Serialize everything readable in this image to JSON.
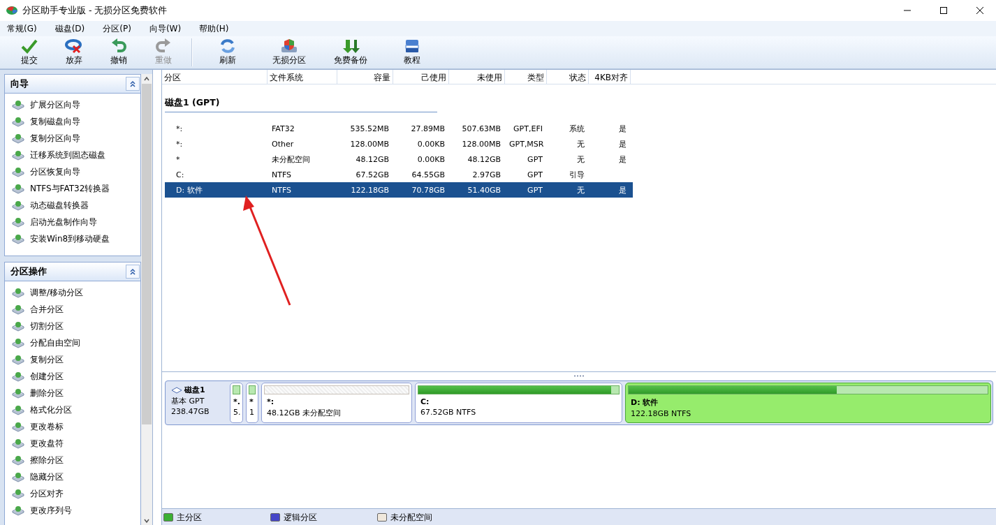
{
  "window": {
    "title": "分区助手专业版 - 无损分区免费软件"
  },
  "menu": [
    "常规(G)",
    "磁盘(D)",
    "分区(P)",
    "向导(W)",
    "帮助(H)"
  ],
  "toolbar": {
    "groups": [
      [
        {
          "kind": "check",
          "label": "提交",
          "disabled": false
        },
        {
          "kind": "discard",
          "label": "放弃",
          "disabled": false
        },
        {
          "kind": "undo",
          "label": "撤销",
          "disabled": false
        },
        {
          "kind": "redo",
          "label": "重做",
          "disabled": true
        }
      ],
      [
        {
          "kind": "refresh",
          "label": "刷新",
          "disabled": false
        },
        {
          "kind": "shield",
          "label": "无损分区",
          "disabled": false
        },
        {
          "kind": "backup",
          "label": "免费备份",
          "disabled": false
        },
        {
          "kind": "book",
          "label": "教程",
          "disabled": false
        }
      ]
    ]
  },
  "sidebar": {
    "panels": [
      {
        "title": "向导",
        "expanded": true,
        "items": [
          "扩展分区向导",
          "复制磁盘向导",
          "复制分区向导",
          "迁移系统到固态磁盘",
          "分区恢复向导",
          "NTFS与FAT32转换器",
          "动态磁盘转换器",
          "启动光盘制作向导",
          "安装Win8到移动硬盘"
        ]
      },
      {
        "title": "分区操作",
        "expanded": true,
        "items": [
          "调整/移动分区",
          "合并分区",
          "切割分区",
          "分配自由空间",
          "复制分区",
          "创建分区",
          "删除分区",
          "格式化分区",
          "更改卷标",
          "更改盘符",
          "擦除分区",
          "隐藏分区",
          "分区对齐",
          "更改序列号"
        ]
      }
    ]
  },
  "table": {
    "columns": [
      "分区",
      "文件系统",
      "容量",
      "己使用",
      "未使用",
      "类型",
      "状态",
      "4KB对齐"
    ],
    "group": "磁盘1 (GPT)",
    "rows": [
      {
        "cells": [
          "*:",
          "FAT32",
          "535.52MB",
          "27.89MB",
          "507.63MB",
          "GPT,EFI",
          "系统",
          "是"
        ],
        "selected": false
      },
      {
        "cells": [
          "*:",
          "Other",
          "128.00MB",
          "0.00KB",
          "128.00MB",
          "GPT,MSR",
          "无",
          "是"
        ],
        "selected": false
      },
      {
        "cells": [
          "*",
          "未分配空间",
          "48.12GB",
          "0.00KB",
          "48.12GB",
          "GPT",
          "无",
          "是"
        ],
        "selected": false
      },
      {
        "cells": [
          "C:",
          "NTFS",
          "67.52GB",
          "64.55GB",
          "2.97GB",
          "GPT",
          "引导",
          ""
        ],
        "selected": false
      },
      {
        "cells": [
          "D: 软件",
          "NTFS",
          "122.18GB",
          "70.78GB",
          "51.40GB",
          "GPT",
          "无",
          "是"
        ],
        "selected": true
      }
    ]
  },
  "disk_map": {
    "disk": {
      "name": "磁盘1",
      "type": "基本 GPT",
      "size": "238.47GB"
    },
    "partitions": [
      {
        "kind": "primary",
        "label": "*.",
        "detail": "5.",
        "selected": false
      },
      {
        "kind": "primary",
        "label": "*",
        "detail": "1",
        "selected": false
      },
      {
        "kind": "unallocated",
        "label": "*:",
        "detail": "48.12GB 未分配空间",
        "selected": false
      },
      {
        "kind": "primary",
        "label": "C:",
        "detail": "67.52GB NTFS",
        "level": 0.96,
        "selected": false
      },
      {
        "kind": "primary",
        "label": "D: 软件",
        "detail": "122.18GB NTFS",
        "level": 0.58,
        "selected": true
      }
    ]
  },
  "legend": [
    {
      "label": "主分区",
      "color": "#3cb034"
    },
    {
      "label": "逻辑分区",
      "color": "#4646c8"
    },
    {
      "label": "未分配空间",
      "color": "#f0e8dc"
    }
  ]
}
